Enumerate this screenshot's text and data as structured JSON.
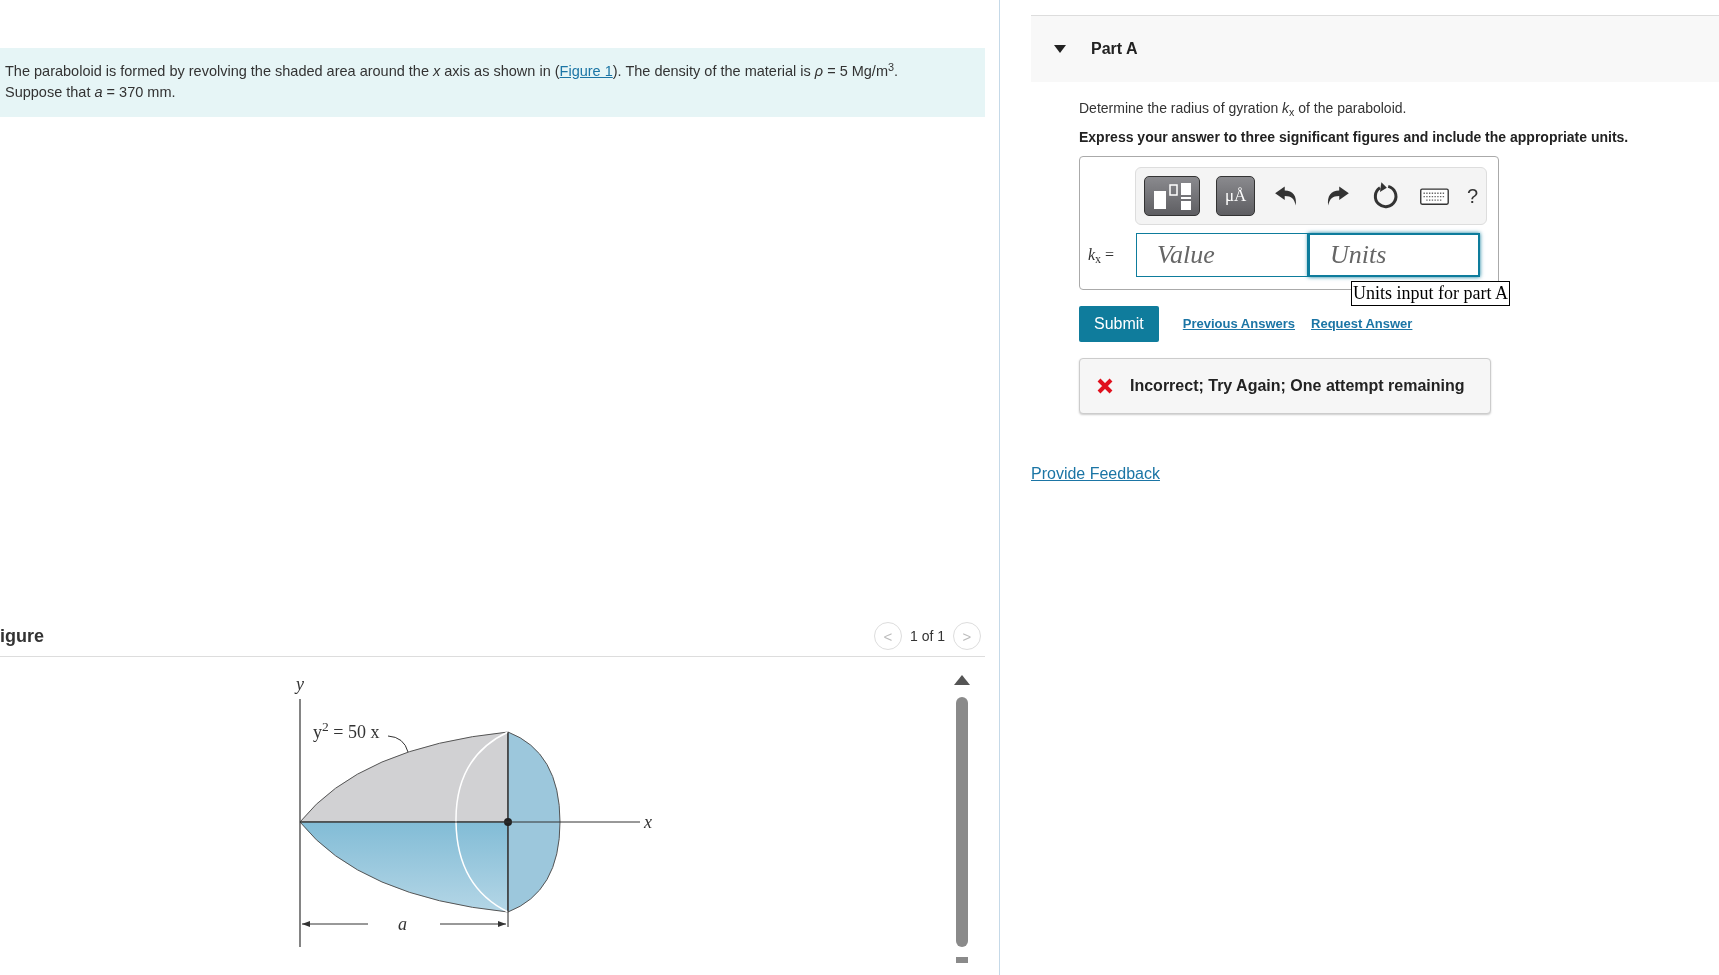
{
  "intro": {
    "before": "The paraboloid is formed by revolving the shaded area around the *x* axis as shown in (",
    "link": "Figure 1",
    "after": "). The density of the material is *ρ* = 5 Mg/m$^{3}$.",
    "line2": "Suppose that *a* = 370 mm."
  },
  "figure": {
    "title": "igure",
    "pager": {
      "prev": "<",
      "count": "1 of 1",
      "next": ">",
      "prev_disabled": true,
      "next_disabled": true
    },
    "labels": {
      "y_axis": "y",
      "x_axis": "x",
      "equation": "y$^{2}$ = 50 x",
      "dimension": "a"
    }
  },
  "part": {
    "title": "Part A",
    "expanded": true,
    "question": "Determine the radius of gyration *k*$_{x}$ of the paraboloid.",
    "instruction": "Express your answer to three significant figures and include the appropriate units.",
    "toolbar": {
      "units_button": "μÅ",
      "help": "?"
    },
    "answer": {
      "label": "*k*$_{x}$ =",
      "value_placeholder": "Value",
      "units_placeholder": "Units",
      "units_focused": true,
      "tooltip": "Units input for part A"
    },
    "submit": "Submit",
    "links": [
      "Previous Answers",
      "Request Answer"
    ],
    "feedback": {
      "kind": "incorrect",
      "text": "Incorrect; Try Again; One attempt remaining"
    }
  },
  "provide_feedback": "Provide Feedback"
}
